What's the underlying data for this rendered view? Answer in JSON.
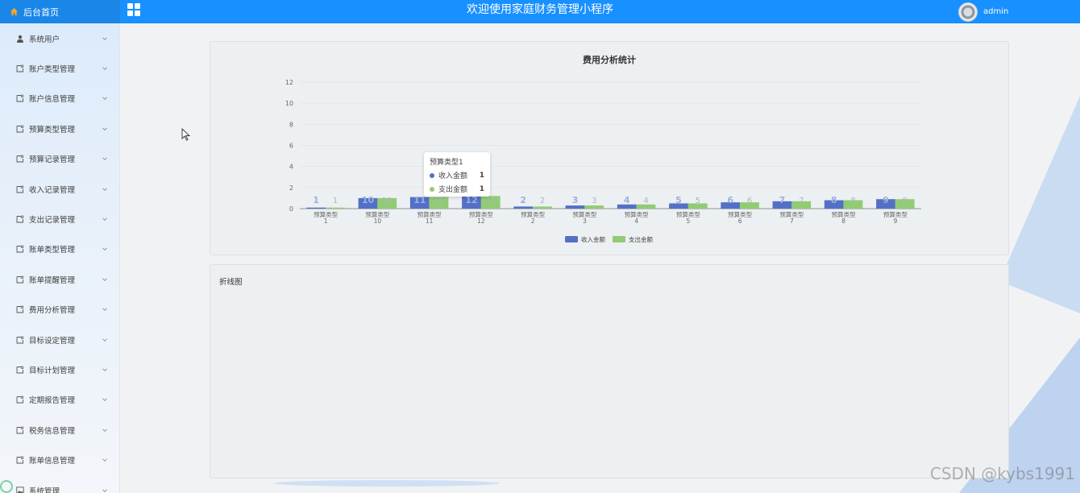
{
  "header": {
    "home_label": "后台首页",
    "app_title": "欢迎使用家庭财务管理小程序",
    "username": "admin"
  },
  "sidebar": {
    "items": [
      {
        "label": "系统用户",
        "icon": "user-icon"
      },
      {
        "label": "账户类型管理",
        "icon": "note-icon"
      },
      {
        "label": "账户信息管理",
        "icon": "note-icon"
      },
      {
        "label": "预算类型管理",
        "icon": "note-icon"
      },
      {
        "label": "预算记录管理",
        "icon": "note-icon"
      },
      {
        "label": "收入记录管理",
        "icon": "note-icon"
      },
      {
        "label": "支出记录管理",
        "icon": "note-icon"
      },
      {
        "label": "账单类型管理",
        "icon": "note-icon"
      },
      {
        "label": "账单提醒管理",
        "icon": "note-icon"
      },
      {
        "label": "费用分析管理",
        "icon": "note-icon"
      },
      {
        "label": "目标设定管理",
        "icon": "note-icon"
      },
      {
        "label": "目标计划管理",
        "icon": "note-icon"
      },
      {
        "label": "定期报告管理",
        "icon": "note-icon"
      },
      {
        "label": "税务信息管理",
        "icon": "note-icon"
      },
      {
        "label": "账单信息管理",
        "icon": "note-icon"
      },
      {
        "label": "系统管理",
        "icon": "image-icon"
      }
    ]
  },
  "chart_card": {
    "title": "费用分析统计"
  },
  "line_card": {
    "title": "折线图"
  },
  "tooltip": {
    "title": "预算类型1",
    "rows": [
      {
        "label": "收入金额",
        "value": "1",
        "color": "#5470c6"
      },
      {
        "label": "支出金额",
        "value": "1",
        "color": "#91cc75"
      }
    ]
  },
  "chart_data": {
    "type": "bar",
    "title": "费用分析统计",
    "categories": [
      "预算类型1",
      "预算类型10",
      "预算类型11",
      "预算类型12",
      "预算类型2",
      "预算类型3",
      "预算类型4",
      "预算类型5",
      "预算类型6",
      "预算类型7",
      "预算类型8",
      "预算类型9"
    ],
    "series": [
      {
        "name": "收入金额",
        "values": [
          1,
          10,
          11,
          12,
          2,
          3,
          4,
          5,
          6,
          7,
          8,
          9
        ],
        "color": "#5470c6"
      },
      {
        "name": "支出金额",
        "values": [
          1,
          10,
          11,
          12,
          2,
          3,
          4,
          5,
          6,
          7,
          8,
          9
        ],
        "color": "#91cc75"
      }
    ],
    "y_ticks": [
      "0",
      "2",
      "4",
      "6",
      "8",
      "10",
      "12"
    ],
    "ylim": [
      0,
      120
    ],
    "grid": true,
    "legend_position": "bottom-center"
  },
  "watermark": "CSDN @kybs1991",
  "colors": {
    "header_bg": "#1890ff",
    "income": "#5470c6",
    "expense": "#91cc75"
  }
}
